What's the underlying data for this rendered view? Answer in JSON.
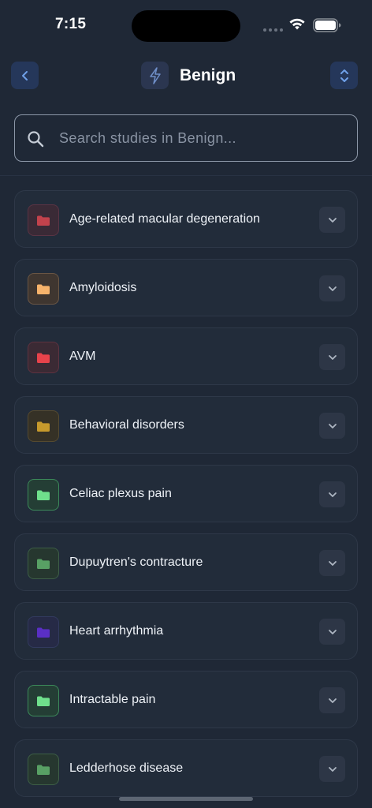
{
  "status_bar": {
    "time": "7:15"
  },
  "header": {
    "title": "Benign"
  },
  "search": {
    "placeholder": "Search studies in Benign..."
  },
  "studies": [
    {
      "label": "Age-related macular degeneration",
      "folder_color": "#c2424c",
      "box_bg": "#3a2a36",
      "box_border": "#5a3444"
    },
    {
      "label": "Amyloidosis",
      "folder_color": "#f7b36b",
      "box_bg": "#3f3630",
      "box_border": "#6a5644"
    },
    {
      "label": "AVM",
      "folder_color": "#e8434b",
      "box_bg": "#3b2a34",
      "box_border": "#5e3240"
    },
    {
      "label": "Behavioral disorders",
      "folder_color": "#c79a2c",
      "box_bg": "#353126",
      "box_border": "#554a30"
    },
    {
      "label": "Celiac plexus pain",
      "folder_color": "#6fe08c",
      "box_bg": "#243e35",
      "box_border": "#3c8a5a"
    },
    {
      "label": "Dupuytren's contracture",
      "folder_color": "#58a064",
      "box_bg": "#26372f",
      "box_border": "#3d5e46"
    },
    {
      "label": "Heart arrhythmia",
      "folder_color": "#5a2fc4",
      "box_bg": "#262a46",
      "box_border": "#323a5e"
    },
    {
      "label": "Intractable pain",
      "folder_color": "#6fe08c",
      "box_bg": "#243e35",
      "box_border": "#3c8a5a"
    },
    {
      "label": "Ledderhose disease",
      "folder_color": "#58a064",
      "box_bg": "#26372f",
      "box_border": "#3d5e46"
    }
  ],
  "icons": {
    "back": "chevron-left-icon",
    "title": "bolt-icon",
    "sort": "chevron-up-down-icon",
    "search": "search-icon",
    "folder": "folder-icon",
    "expand": "chevron-down-icon"
  },
  "colors": {
    "background": "#1f2836",
    "accent_button": "#25375a",
    "accent_icon": "#6fa0e8"
  }
}
